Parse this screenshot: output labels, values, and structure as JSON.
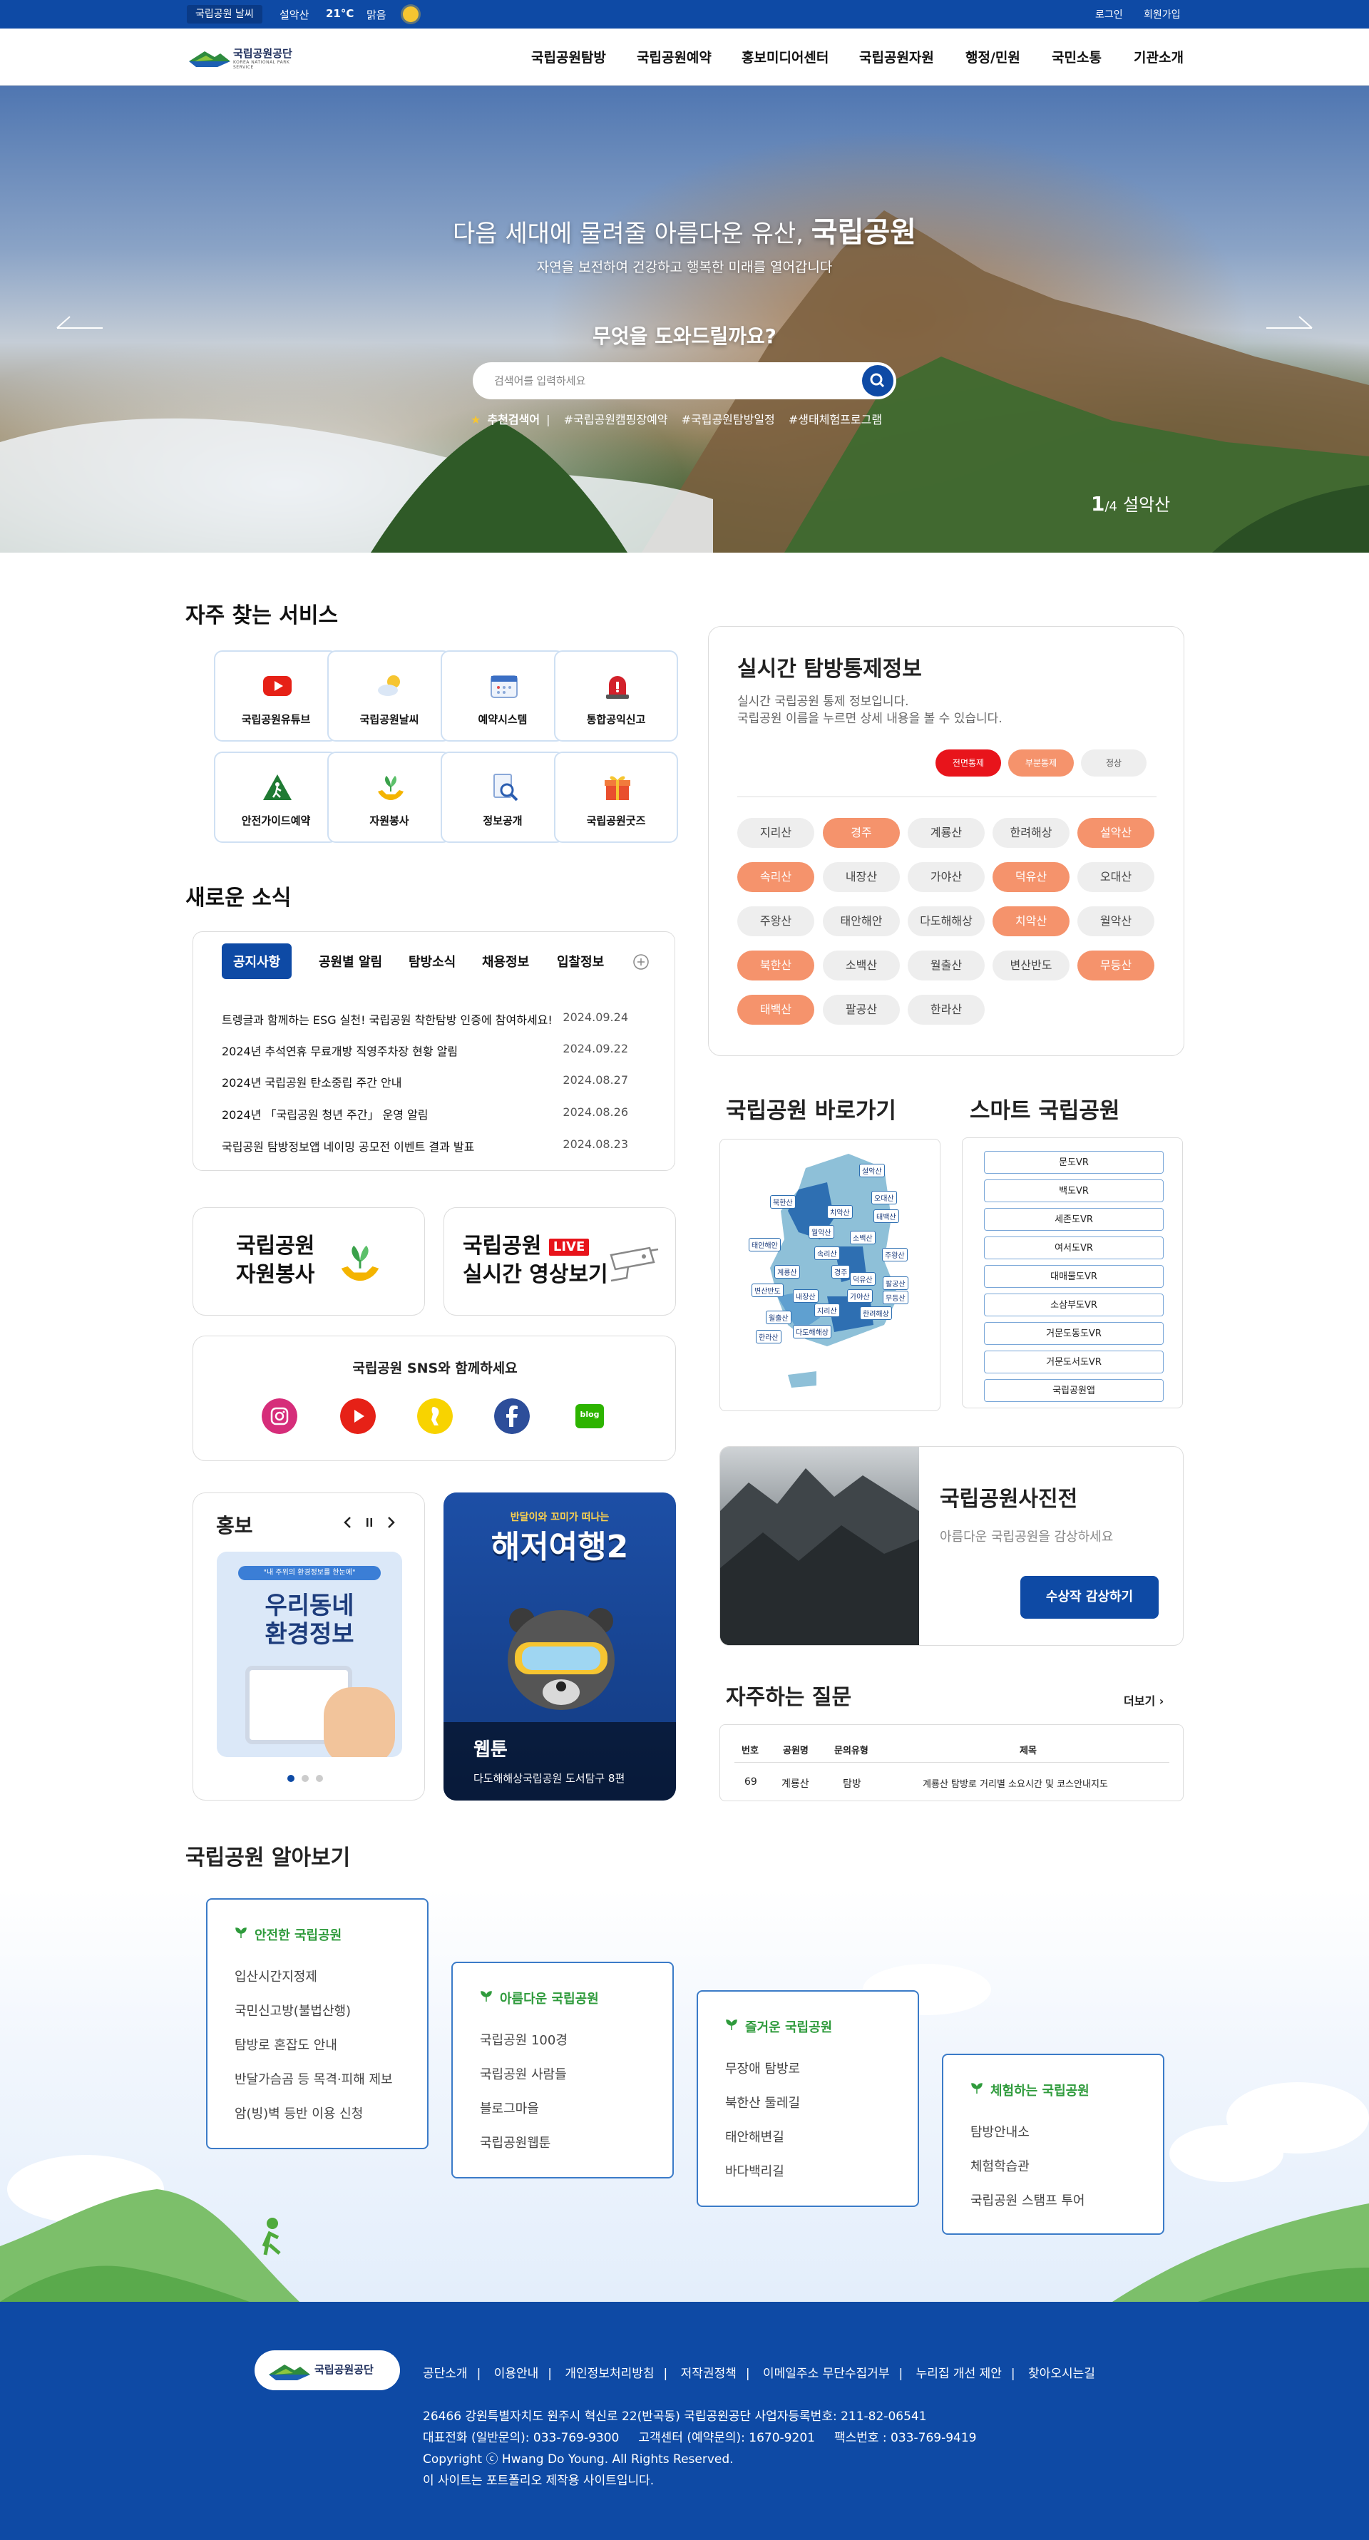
{
  "topbar": {
    "weather_tag": "국립공원 날씨",
    "location": "설악산",
    "temp": "21°C",
    "condition": "맑음",
    "login": "로그인",
    "join": "회원가입"
  },
  "header": {
    "logo_name": "국립공원공단",
    "logo_sub": "KOREA NATIONAL PARK SERVICE",
    "nav": [
      "국립공원탐방",
      "국립공원예약",
      "홍보미디어센터",
      "국립공원자원",
      "행정/민원",
      "국민소통",
      "기관소개"
    ]
  },
  "hero": {
    "title": "다음 세대에 물려줄 아름다운 유산,",
    "title_bold": "국립공원",
    "subtitle": "자연을 보전하여 건강하고 행복한 미래를 열어갑니다",
    "question": "무엇을 도와드릴까요?",
    "search_placeholder": "검색어를 입력하세요",
    "tags_label": "추천검색어",
    "tags": [
      "#국립공원캠핑장예약",
      "#국립공원탐방일정",
      "#생태체험프로그램"
    ],
    "counter_current": "1",
    "counter_total": "/4",
    "counter_name": "설악산"
  },
  "services": {
    "title": "자주 찾는 서비스",
    "items": [
      {
        "label": "국립공원유튜브",
        "icon": "youtube-icon"
      },
      {
        "label": "국립공원날씨",
        "icon": "weather-icon"
      },
      {
        "label": "예약시스템",
        "icon": "calendar-icon"
      },
      {
        "label": "통합공익신고",
        "icon": "alert-icon"
      },
      {
        "label": "안전가이드예약",
        "icon": "hiker-icon"
      },
      {
        "label": "자원봉사",
        "icon": "sprout-hands-icon"
      },
      {
        "label": "정보공개",
        "icon": "document-search-icon"
      },
      {
        "label": "국립공원굿즈",
        "icon": "gift-icon"
      }
    ]
  },
  "control": {
    "title": "실시간 탐방통제정보",
    "desc1": "실시간 국립공원 통제 정보입니다.",
    "desc2": "국립공원 이름을 누르면 상세 내용을 볼 수 있습니다.",
    "legend": [
      "전면통제",
      "부분통제",
      "정상"
    ],
    "legend_colors": {
      "full": "#e8141b",
      "partial": "#f5936c",
      "normal": "#eeeeee"
    },
    "parks": [
      {
        "name": "지리산",
        "status": "normal"
      },
      {
        "name": "경주",
        "status": "partial"
      },
      {
        "name": "계룡산",
        "status": "normal"
      },
      {
        "name": "한려해상",
        "status": "normal"
      },
      {
        "name": "설악산",
        "status": "partial"
      },
      {
        "name": "속리산",
        "status": "partial"
      },
      {
        "name": "내장산",
        "status": "normal"
      },
      {
        "name": "가야산",
        "status": "normal"
      },
      {
        "name": "덕유산",
        "status": "partial"
      },
      {
        "name": "오대산",
        "status": "normal"
      },
      {
        "name": "주왕산",
        "status": "normal"
      },
      {
        "name": "태안해안",
        "status": "normal"
      },
      {
        "name": "다도해해상",
        "status": "normal"
      },
      {
        "name": "치악산",
        "status": "partial"
      },
      {
        "name": "월악산",
        "status": "normal"
      },
      {
        "name": "북한산",
        "status": "partial"
      },
      {
        "name": "소백산",
        "status": "normal"
      },
      {
        "name": "월출산",
        "status": "normal"
      },
      {
        "name": "변산반도",
        "status": "normal"
      },
      {
        "name": "무등산",
        "status": "partial"
      },
      {
        "name": "태백산",
        "status": "partial"
      },
      {
        "name": "팔공산",
        "status": "normal"
      },
      {
        "name": "한라산",
        "status": "normal"
      }
    ]
  },
  "news": {
    "title": "새로운 소식",
    "tabs": [
      "공지사항",
      "공원별 알림",
      "탐방소식",
      "채용정보",
      "입찰정보"
    ],
    "rows": [
      {
        "title": "트렝글과 함께하는 ESG 실천! 국립공원 착한탐방 인증에 참여하세요!",
        "date": "2024.09.24"
      },
      {
        "title": "2024년 추석연휴 무료개방 직영주차장 현황 알림",
        "date": "2024.09.22"
      },
      {
        "title": "2024년 국립공원 탄소중립 주간 안내",
        "date": "2024.08.27"
      },
      {
        "title": "2024년 「국립공원 청년 주간」 운영 알림",
        "date": "2024.08.26"
      },
      {
        "title": "국립공원 탐방정보앱 네이밍 공모전 이벤트 결과 발표",
        "date": "2024.08.23"
      }
    ]
  },
  "shortcut": {
    "title": "국립공원 바로가기",
    "map_labels": [
      "설악산",
      "오대산",
      "북한산",
      "치악산",
      "태백산",
      "월악산",
      "소백산",
      "주왕산",
      "태안해안",
      "속리산",
      "계룡산",
      "경주",
      "덕유산",
      "팔공산",
      "변산반도",
      "내장산",
      "가야산",
      "무등산",
      "지리산",
      "한려해상",
      "월출산",
      "다도해해상",
      "한라산"
    ]
  },
  "smart": {
    "title": "스마트 국립공원",
    "items": [
      "문도VR",
      "백도VR",
      "세존도VR",
      "여서도VR",
      "대매물도VR",
      "소삼부도VR",
      "거문도동도VR",
      "거문도서도VR",
      "국립공원앱"
    ]
  },
  "volunteer": {
    "line1": "국립공원",
    "line2": "자원봉사"
  },
  "live": {
    "line1": "국립공원",
    "badge": "LIVE",
    "line2": "실시간 영상보기"
  },
  "sns": {
    "title": "국립공원 SNS와 함께하세요",
    "items": [
      "instagram-icon",
      "youtube-icon",
      "kakaostory-icon",
      "facebook-icon",
      "blog-icon"
    ],
    "blog_text": "blog"
  },
  "promo": {
    "title": "홍보",
    "poster_top": "\"내 주위의 환경정보를 한눈에\"",
    "poster_title1": "우리동네",
    "poster_title2": "환경정보"
  },
  "webtoon": {
    "top": "반달이와 꼬미가 떠나는",
    "title": "해저여행2",
    "label": "웹툰",
    "caption": "다도해해상국립공원 도서탐구 8편"
  },
  "photo": {
    "title": "국립공원사진전",
    "desc": "아름다운 국립공원을 감상하세요",
    "button": "수상작 감상하기"
  },
  "faq": {
    "title": "자주하는 질문",
    "more": "더보기",
    "headers": [
      "번호",
      "공원명",
      "문의유형",
      "제목"
    ],
    "rows": [
      {
        "no": "69",
        "park": "계룡산",
        "type": "탐방",
        "title": "계룡산 탐방로 거리별 소요시간 및 코스안내지도"
      }
    ]
  },
  "explore": {
    "title": "국립공원 알아보기",
    "cards": [
      {
        "heading": "안전한 국립공원",
        "items": [
          "입산시간지정제",
          "국민신고방(불법산행)",
          "탐방로 혼잡도 안내",
          "반달가슴곰 등 목격·피해 제보",
          "암(빙)벽 등반 이용 신청"
        ]
      },
      {
        "heading": "아름다운 국립공원",
        "items": [
          "국립공원 100경",
          "국립공원 사람들",
          "블로그마을",
          "국립공원웹툰"
        ]
      },
      {
        "heading": "즐거운 국립공원",
        "items": [
          "무장애 탐방로",
          "북한산 둘레길",
          "태안해변길",
          "바다백리길"
        ]
      },
      {
        "heading": "체험하는 국립공원",
        "items": [
          "탐방안내소",
          "체험학습관",
          "국립공원 스탬프 투어"
        ]
      }
    ]
  },
  "footer": {
    "logo_name": "국립공원공단",
    "links": [
      "공단소개",
      "이용안내",
      "개인정보처리방침",
      "저작권정책",
      "이메일주소 무단수집거부",
      "누리집 개선 제안",
      "찾아오시는길"
    ],
    "address": "26466 강원특별자치도 원주시 혁신로 22(반곡동) 국립공원공단 사업자등록번호: 211-82-06541",
    "phones": "대표전화 (일반문의): 033-769-9300     고객센터 (예약문의): 1670-9201     팩스번호 : 033-769-9419",
    "copyright": "Copyright ⓒ Hwang Do Young. All Rights Reserved.",
    "note": "이 사이트는 포트폴리오 제작용 사이트입니다."
  },
  "colors": {
    "brand": "#0e4aa5",
    "accent_orange": "#f5936c",
    "accent_red": "#e8141b",
    "green": "#2f9b3c"
  }
}
